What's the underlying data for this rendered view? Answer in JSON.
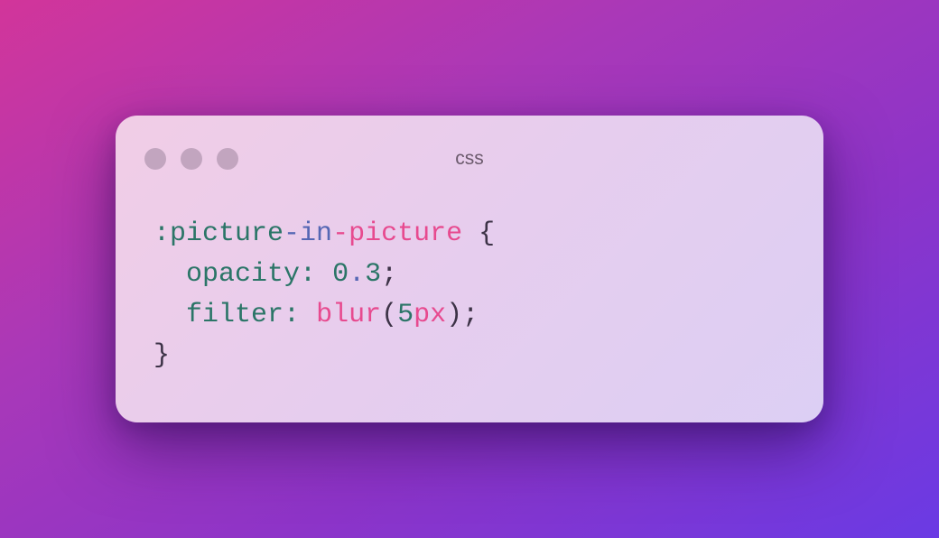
{
  "window": {
    "title": "css",
    "traffic_lights": [
      "close-button",
      "minimize-button",
      "maximize-button"
    ],
    "colors": {
      "background_gradient": [
        "#d2359a",
        "#6a3ae4"
      ],
      "card": "#e9cdeb",
      "dot": "#c2a5bf",
      "selector": "#2b7567",
      "accent_blue": "#5567b4",
      "accent_pink": "#e74a8f"
    }
  },
  "code": {
    "line1": {
      "selector_start": ":picture",
      "dash1": "-",
      "in": "in",
      "dash2": "-",
      "picture": "picture",
      "brace_open": " {"
    },
    "line2": {
      "indent": "  ",
      "property": "opacity",
      "colon": ": ",
      "num_int": "0",
      "num_dot": ".",
      "num_frac": "3",
      "semicolon": ";"
    },
    "line3": {
      "indent": "  ",
      "property": "filter",
      "colon": ": ",
      "func": "blur",
      "paren_open": "(",
      "num": "5",
      "unit": "px",
      "paren_close": ")",
      "semicolon": ";"
    },
    "line4": {
      "brace_close": "}"
    }
  }
}
